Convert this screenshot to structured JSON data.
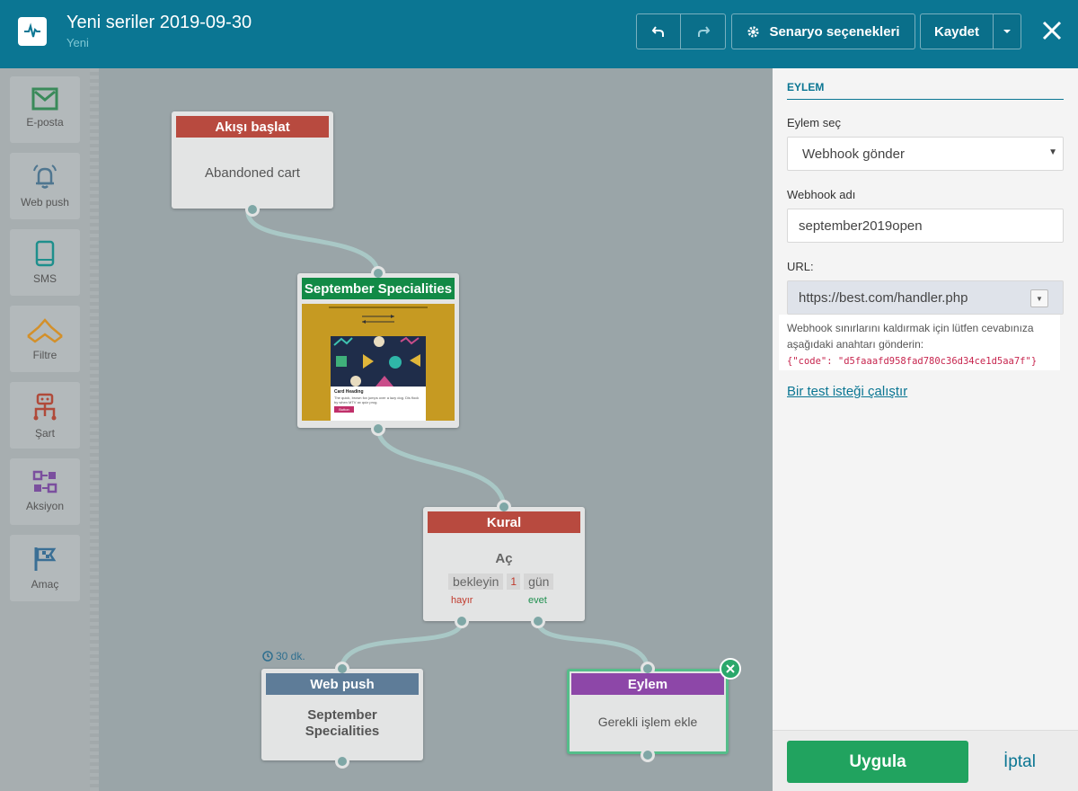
{
  "header": {
    "title": "Yeni seriler 2019-09-30",
    "status": "Yeni",
    "scenario_options": "Senaryo seçenekleri",
    "save": "Kaydet"
  },
  "tools": [
    {
      "label": "E-posta",
      "icon": "email-icon",
      "color": "#3a8a5a"
    },
    {
      "label": "Web push",
      "icon": "bell-icon",
      "color": "#4f7690"
    },
    {
      "label": "SMS",
      "icon": "phone-icon",
      "color": "#1e8f8c"
    },
    {
      "label": "Filtre",
      "icon": "filter-icon",
      "color": "#d3902a"
    },
    {
      "label": "Şart",
      "icon": "condition-icon",
      "color": "#b04a3a"
    },
    {
      "label": "Aksiyon",
      "icon": "action-icon",
      "color": "#7b4f9e"
    },
    {
      "label": "Amaç",
      "icon": "goal-flag-icon",
      "color": "#3a6f95"
    }
  ],
  "nodes": {
    "start": {
      "header": "Akışı başlat",
      "body": "Abandoned cart",
      "color": "#b84a3f"
    },
    "email": {
      "header": "September Specialities",
      "color": "#128a46",
      "preview": {
        "card_heading": "Card Heading",
        "card_text": "The quick, brown fox jumps over a lazy dog. Dis flock by when MTV ax quiz prog.",
        "button": "Button"
      }
    },
    "rule": {
      "header": "Kural",
      "body": "Aç",
      "wait_word": "bekleyin",
      "wait_value": "1",
      "wait_unit": "gün",
      "no": "hayır",
      "yes": "evet",
      "color": "#b84a3f"
    },
    "webpush": {
      "header": "Web push",
      "body": "September Specialities",
      "delay": "30 dk.",
      "color": "#5e7c98"
    },
    "action": {
      "header": "Eylem",
      "body": "Gerekli işlem ekle",
      "color": "#8d47a8"
    }
  },
  "panel": {
    "section_title": "EYLEM",
    "select_label": "Eylem seç",
    "select_value": "Webhook gönder",
    "name_label": "Webhook adı",
    "name_value": "september2019open",
    "url_label": "URL:",
    "url_value": "https://best.com/handler.php",
    "hint_text": "Webhook sınırlarını kaldırmak için lütfen cevabınıza aşağıdaki anahtarı gönderin:",
    "hint_code": "{\"code\": \"d5faaafd958fad780c36d34ce1d5aa7f\"}",
    "test_link": "Bir test isteği çalıştır",
    "apply": "Uygula",
    "cancel": "İptal"
  }
}
